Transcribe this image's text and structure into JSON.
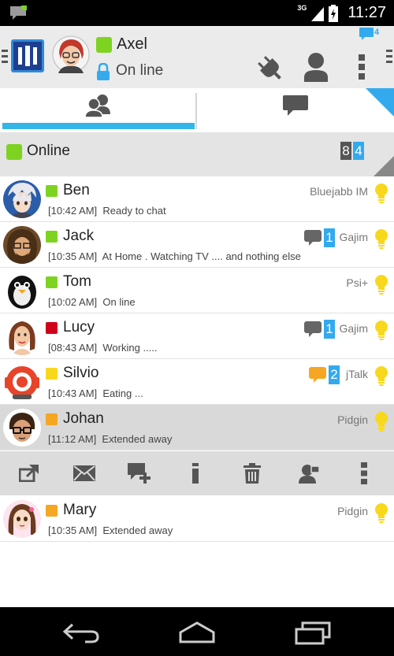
{
  "status_bar": {
    "network": "3G",
    "time": "11:27",
    "icons": [
      "notification-message-icon",
      "signal-icon",
      "battery-icon"
    ]
  },
  "header": {
    "user_name": "Axel",
    "user_status": "On line",
    "unread_messages": "4",
    "icons": [
      "app-logo-icon",
      "lock-icon",
      "plug-icon",
      "account-icon",
      "overflow-menu-icon"
    ]
  },
  "tabs": [
    {
      "name": "contacts",
      "icon": "contacts-icon"
    },
    {
      "name": "chats",
      "icon": "chat-bubble-icon"
    }
  ],
  "group": {
    "label": "Online",
    "count_a": "8",
    "count_b": "4"
  },
  "contacts": [
    {
      "name": "Ben",
      "time": "[10:42 AM]",
      "message": "Ready to chat",
      "client": "Bluejabb IM",
      "status_color": "#7ed321",
      "unread": ""
    },
    {
      "name": "Jack",
      "time": "[10:35 AM]",
      "message": "At Home . Watching TV .... and nothing else",
      "client": "Gajim",
      "status_color": "#7ed321",
      "unread": "1"
    },
    {
      "name": "Tom",
      "time": "[10:02 AM]",
      "message": "On line",
      "client": "Psi+",
      "status_color": "#7ed321",
      "unread": ""
    },
    {
      "name": "Lucy",
      "time": "[08:43 AM]",
      "message": "Working .....",
      "client": "Gajim",
      "status_color": "#d0021b",
      "unread": "1"
    },
    {
      "name": "Silvio",
      "time": "[10:43 AM]",
      "message": "Eating ...",
      "client": "jTalk",
      "status_color": "#f8d81c",
      "unread": "2"
    },
    {
      "name": "Johan",
      "time": "[11:12 AM]",
      "message": "Extended away",
      "client": "Pidgin",
      "status_color": "#f5a623",
      "unread": ""
    },
    {
      "name": "Mary",
      "time": "[10:35 AM]",
      "message": "Extended away",
      "client": "Pidgin",
      "status_color": "#f5a623",
      "unread": ""
    }
  ],
  "action_bar": [
    "open-chat-icon",
    "mail-icon",
    "add-chat-icon",
    "info-icon",
    "delete-icon",
    "contact-info-icon",
    "overflow-menu-icon"
  ],
  "nav_bar": [
    "back-icon",
    "home-icon",
    "recent-apps-icon"
  ],
  "colors": {
    "accent": "#33aaee",
    "online": "#7ed321",
    "busy": "#d0021b",
    "away": "#f8d81c",
    "xa": "#f5a623",
    "bulb": "#f8d81c"
  }
}
